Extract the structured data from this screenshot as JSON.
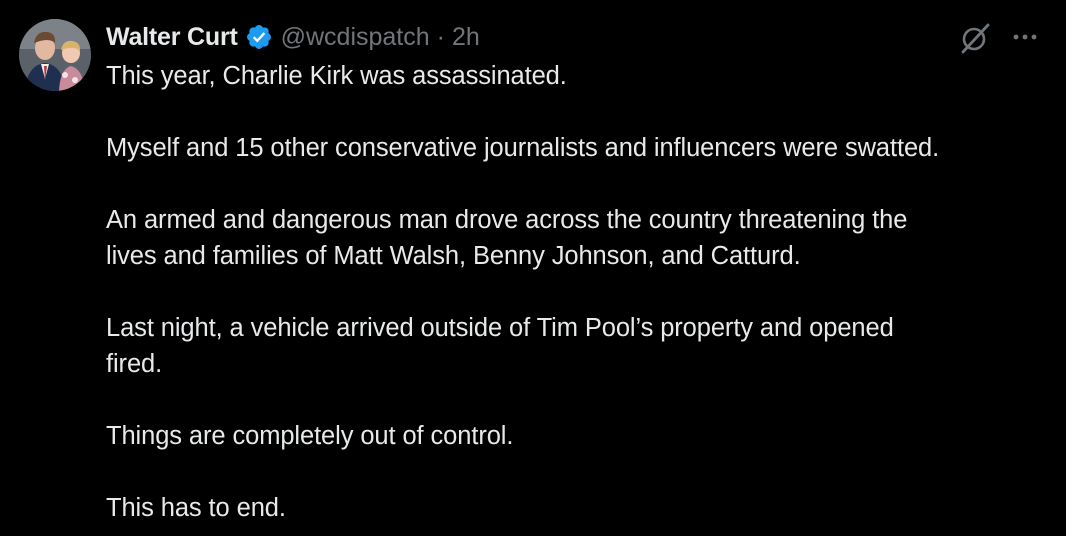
{
  "tweet": {
    "author": {
      "display_name": "Walter Curt",
      "handle": "@wcdispatch",
      "separator": "·",
      "time": "2h",
      "verified_color": "#1d9bf0"
    },
    "paragraphs": [
      "This year, Charlie Kirk was assassinated.",
      "Myself and 15 other conservative journalists and influencers were swatted.",
      "An armed and dangerous man drove across the country threatening the\nlives and families of Matt Walsh, Benny Johnson, and Catturd.",
      "Last night, a vehicle arrived outside of Tim Pool’s property and opened\nfired.",
      "Things are completely out of control.",
      "This has to end."
    ],
    "icons": {
      "verified": "verified-badge-icon",
      "grok": "grok-icon",
      "more": "more-icon"
    }
  },
  "colors": {
    "background": "#000000",
    "primary_text": "#e7e9ea",
    "secondary_text": "#71767b",
    "accent": "#1d9bf0"
  }
}
